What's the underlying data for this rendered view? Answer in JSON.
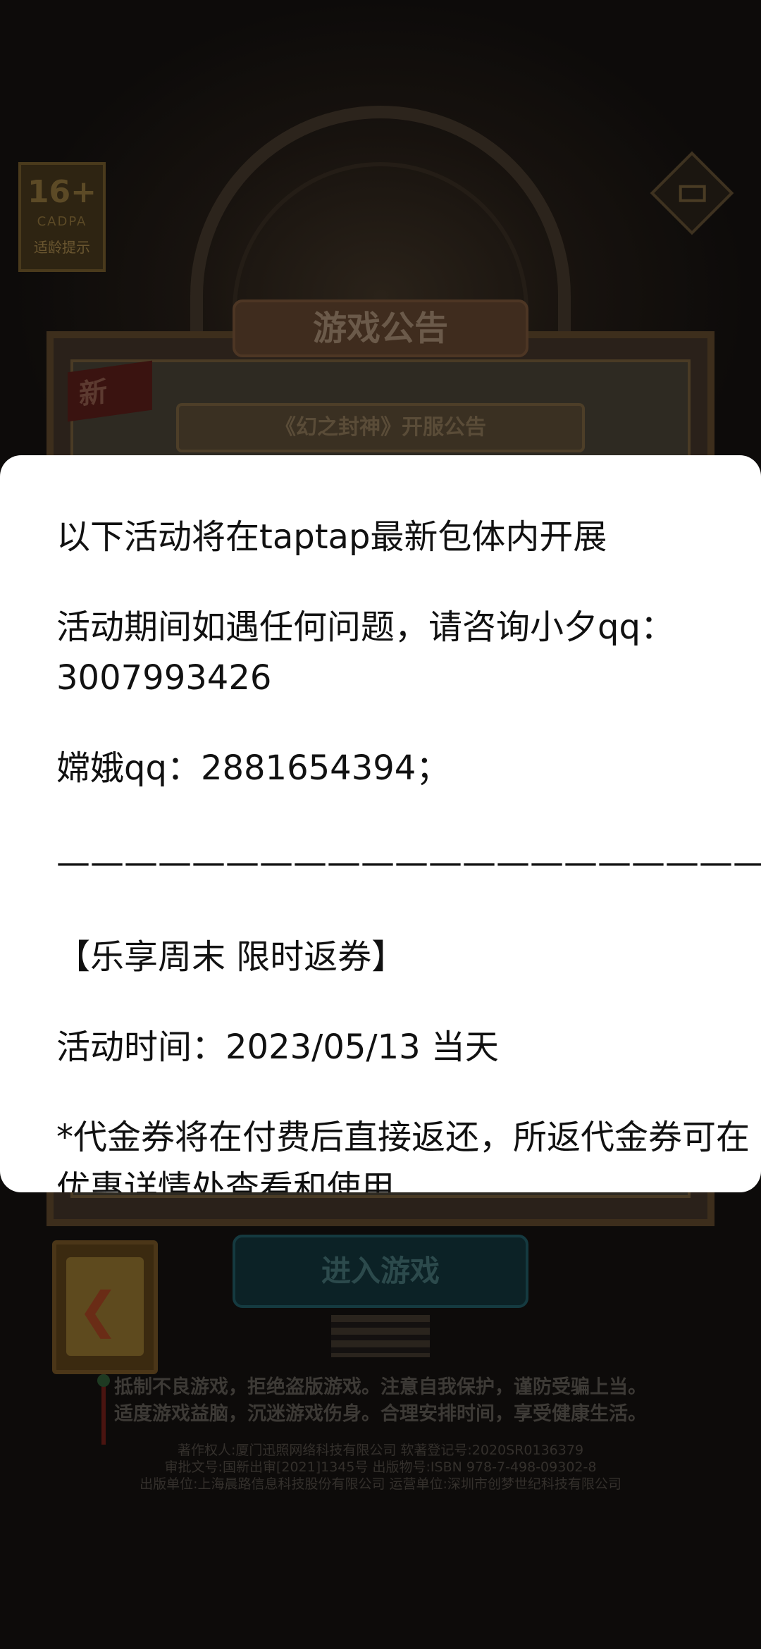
{
  "background": {
    "age_rating": {
      "age": "16+",
      "org": "CADPA",
      "tip": "适龄提示"
    },
    "notice_title": "游戏公告",
    "new_badge": "新",
    "notice_subtitle": "《幻之封神》开服公告",
    "enter_button": "进入游戏",
    "back_button_icon": "back-arrow-icon",
    "health_notice": [
      "抵制不良游戏，拒绝盗版游戏。注意自我保护，谨防受骗上当。",
      "适度游戏益脑，沉迷游戏伤身。合理安排时间，享受健康生活。"
    ],
    "copyright": [
      "著作权人:厦门迅照网络科技有限公司 软著登记号:2020SR0136379",
      "审批文号:国新出审[2021]1345号 出版物号:ISBN 978-7-498-09302-8",
      "出版单位:上海晨路信息科技股份有限公司 运营单位:深圳市创梦世纪科技有限公司"
    ]
  },
  "dialog": {
    "line1": "以下活动将在taptap最新包体内开展",
    "line2": "活动期间如遇任何问题，请咨询小夕qq：3007993426",
    "line3": "嫦娥qq：2881654394；",
    "divider": "——————————————————————",
    "line4": "【乐享周末 限时返券】",
    "line5": "活动时间：2023/05/13 当天",
    "line6": "*代金券将在付费后直接返还，所返代金券可在优惠详情处查看和使用"
  }
}
